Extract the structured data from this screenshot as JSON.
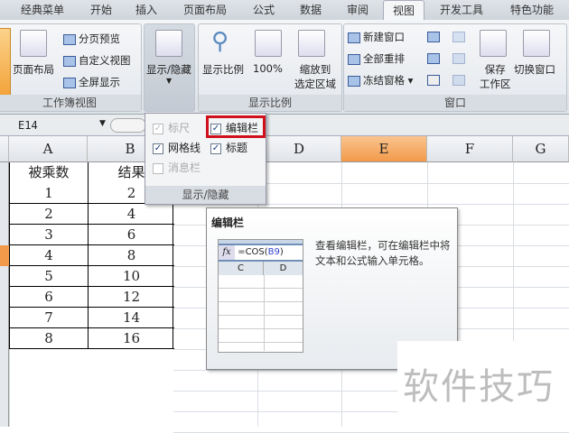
{
  "tabs": [
    "经典菜单",
    "开始",
    "插入",
    "页面布局",
    "公式",
    "数据",
    "审阅",
    "视图",
    "开发工具",
    "特色功能"
  ],
  "active_tab": "视图",
  "ribbon": {
    "workbook_views": {
      "label": "工作簿视图",
      "page_layout": "页面布局",
      "page_break": "分页预览",
      "custom_view": "自定义视图",
      "full_screen": "全屏显示"
    },
    "show_hide": {
      "label": "显示/隐藏"
    },
    "zoom": {
      "label": "显示比例",
      "zoom": "显示比例",
      "hundred": "100%",
      "zoom_sel": "缩放到",
      "zoom_sel2": "选定区域"
    },
    "window": {
      "label": "窗口",
      "new_window": "新建窗口",
      "arrange_all": "全部重排",
      "freeze": "冻结窗格",
      "save_ws": "保存",
      "save_ws2": "工作区",
      "switch": "切换窗口"
    }
  },
  "name_box": "E14",
  "columns": [
    "A",
    "B",
    "C",
    "D",
    "E",
    "F",
    "G"
  ],
  "selected_column": "E",
  "table": {
    "headers": [
      "被乘数",
      "结果"
    ],
    "rows": [
      [
        "1",
        "2"
      ],
      [
        "2",
        "4"
      ],
      [
        "3",
        "6"
      ],
      [
        "4",
        "8"
      ],
      [
        "5",
        "10"
      ],
      [
        "6",
        "12"
      ],
      [
        "7",
        "14"
      ],
      [
        "8",
        "16"
      ]
    ]
  },
  "panel": {
    "ruler": "标尺",
    "formula_bar": "编辑栏",
    "gridlines": "网格线",
    "headings": "标题",
    "message_bar": "消息栏",
    "footer": "显示/隐藏"
  },
  "tooltip": {
    "title": "编辑栏",
    "formula": "=COS(",
    "formula_ref": "B9",
    "formula_end": ")",
    "fx": "fx",
    "col_c": "C",
    "col_d": "D",
    "desc": "查看编辑栏，可在编辑栏中将文本和公式输入单元格。"
  },
  "watermark": "软件技巧",
  "colors": {
    "highlight": "#d0101b",
    "selected_col": "#f7a35c"
  }
}
